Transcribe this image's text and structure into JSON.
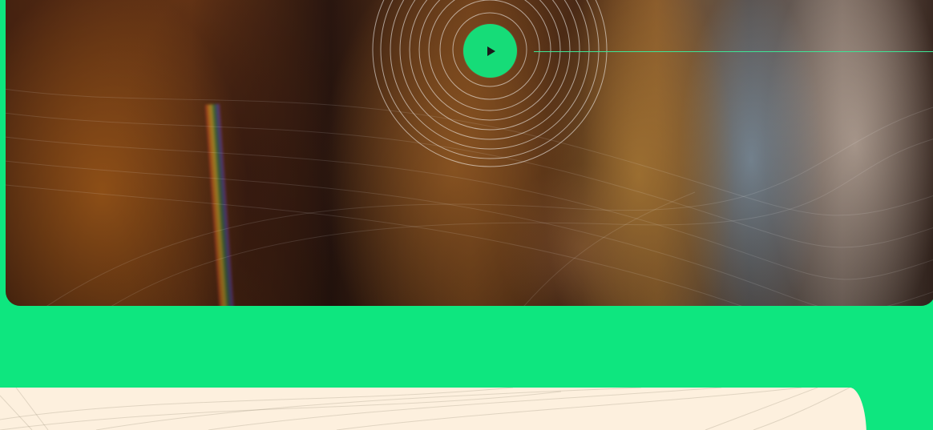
{
  "video": {
    "play_icon": "play-icon",
    "progress": 0
  },
  "colors": {
    "accent_green": "#0ee67f",
    "cream": "#fdf0de",
    "play_fill": "#16dc78",
    "play_glyph": "#1a1a1a"
  }
}
